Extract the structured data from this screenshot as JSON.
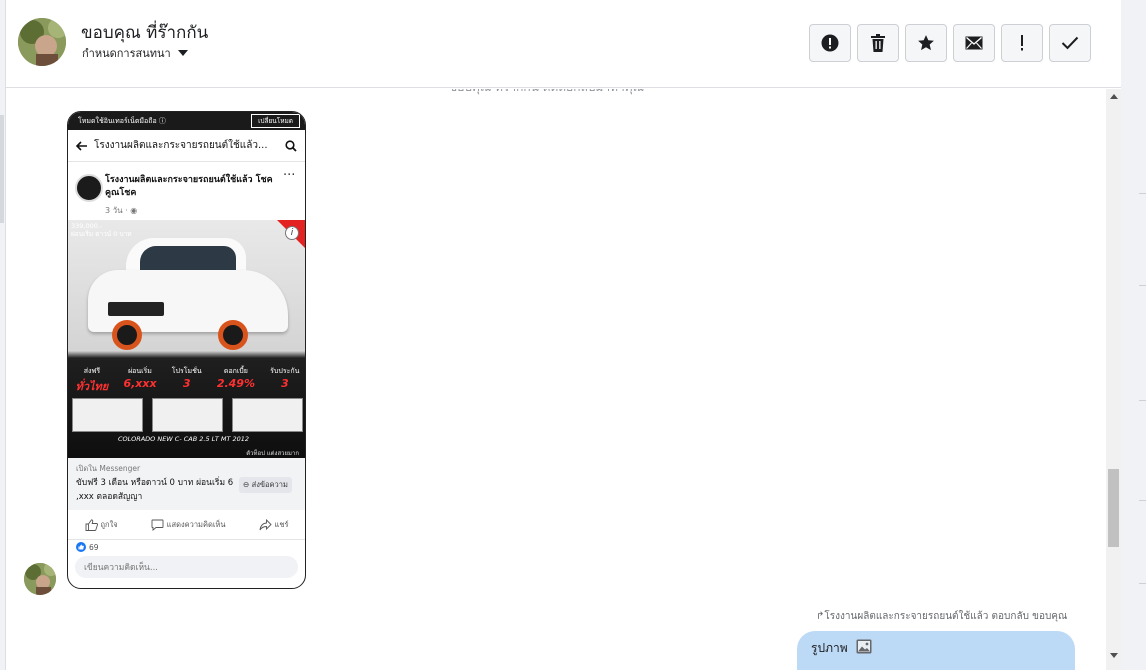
{
  "header": {
    "contact_name": "ขอบคุณ ที่ร๊ากกัน",
    "assign_label": "กำหนดการสนทนา"
  },
  "actions": [
    {
      "icon": "alert-circle-icon"
    },
    {
      "icon": "trash-icon"
    },
    {
      "icon": "star-icon"
    },
    {
      "icon": "envelope-icon"
    },
    {
      "icon": "exclamation-icon"
    },
    {
      "icon": "check-icon"
    }
  ],
  "thread": {
    "cut_text": "ขอบคุณ ที่ร๊ากกัน ติดต่อกลับมาหาคุณ",
    "reply_context": "โรงงานผลิตและกระจายรถยนต์ใช้แล้ว ตอบกลับ ขอบคุณ",
    "image_label": "รูปภาพ"
  },
  "phone": {
    "top_left": "โหมดใช้อินเทอร์เน็ตมือถือ ⓘ",
    "top_right": "เปลี่ยนโหมด",
    "page_title": "โรงงานผลิตและกระจายรถยนต์ใช้แล้ว...",
    "post_page_name": "โรงงานผลิตและกระจายรถยนต์ใช้แล้ว โชคคูณโชค",
    "post_time": "3 วัน · ◉",
    "price_tag": "339,000.-",
    "price_sub": "ผ่อนเริ่ม ดาวน์ 0 บาท",
    "promos": [
      {
        "small": "ส่งฟรี",
        "big": "ทั่วไทย"
      },
      {
        "small": "ผ่อนเริ่ม",
        "big": "6,xxx"
      },
      {
        "small": "โปรโมชั่น",
        "big": "3"
      },
      {
        "small": "ดอกเบี้ย",
        "big": "2.49%"
      },
      {
        "small": "รับประกัน",
        "big": "3"
      }
    ],
    "model": "COLORADO NEW C- CAB 2.5 LT MT 2012",
    "dealer": "ตัวท็อป แต่งสวยมาก",
    "open_in": "เปิดใน Messenger",
    "cta_desc": "ขับฟรี 3 เดือน หรือดาวน์ 0 บาท ผ่อนเริ่ม 6 ,xxx ตลอดสัญญา",
    "send_btn": "⊖ ส่งข้อความ",
    "like": "ถูกใจ",
    "comment": "แสดงความคิดเห็น",
    "share": "แชร์",
    "like_count": "69",
    "comment_placeholder": "เขียนความคิดเห็น..."
  }
}
